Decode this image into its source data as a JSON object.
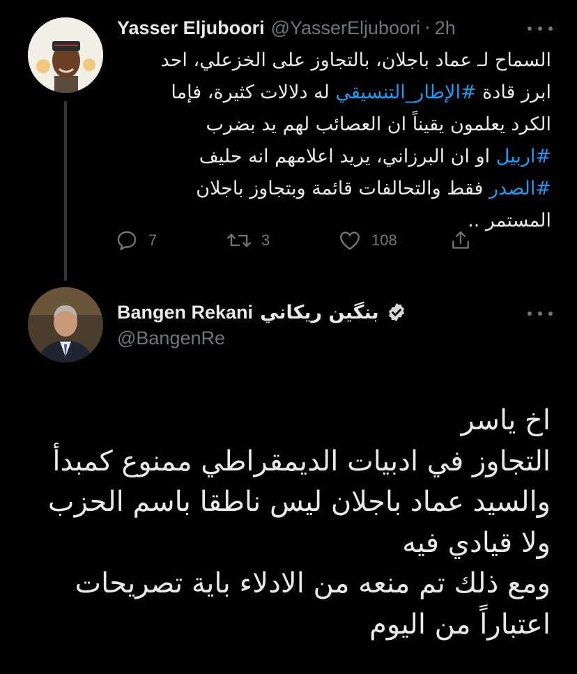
{
  "colors": {
    "background": "#000000",
    "text_primary": "#e7e9ea",
    "text_secondary": "#71767b",
    "hashtag": "#1d9bf0",
    "thread_line": "#333639"
  },
  "tweet_reply_parent": {
    "author_name": "Yasser Eljuboori",
    "author_handle": "@YasserEljuboori",
    "separator": "·",
    "time": "2h",
    "more_icon": "more-horizontal-icon",
    "body_lines": [
      [
        {
          "text": "السماح لـ عماد باجلان، بالتجاوز على الخزعلي، احد"
        }
      ],
      [
        {
          "text": "ابرز قادة "
        },
        {
          "text": "#الإطار_التنسيقي",
          "hashtag": true
        },
        {
          "text": " له دلالات كثيرة، فإما"
        }
      ],
      [
        {
          "text": "الكرد يعلمون يقيناً ان العصائب لهم يد بضرب"
        }
      ],
      [
        {
          "text": "#اربيل",
          "hashtag": true
        },
        {
          "text": " او ان البرزاني، يريد اعلامهم انه حليف"
        }
      ],
      [
        {
          "text": "#الصدر",
          "hashtag": true
        },
        {
          "text": " فقط والتحالفات قائمة وبتجاوز باجلان"
        }
      ],
      [
        {
          "text": "المستمر .."
        }
      ]
    ],
    "actions": {
      "reply_icon": "reply-icon",
      "reply_count": "7",
      "retweet_icon": "retweet-icon",
      "retweet_count": "3",
      "like_icon": "heart-icon",
      "like_count": "108",
      "share_icon": "share-icon"
    }
  },
  "tweet_main": {
    "author_name": "Bangen Rekani",
    "author_name_ar": "بنگين ريكاني",
    "verified_icon": "verified-badge-icon",
    "author_handle": "@BangenRe",
    "more_icon": "more-horizontal-icon",
    "body_lines": [
      "اخ ياسر",
      "التجاوز في ادبيات الديمقراطي ممنوع كمبدأ",
      "والسيد عماد باجلان ليس ناطقا باسم الحزب",
      "ولا قيادي فيه",
      "ومع ذلك تم منعه من الادلاء باية تصريحات",
      "اعتباراً من اليوم"
    ]
  }
}
